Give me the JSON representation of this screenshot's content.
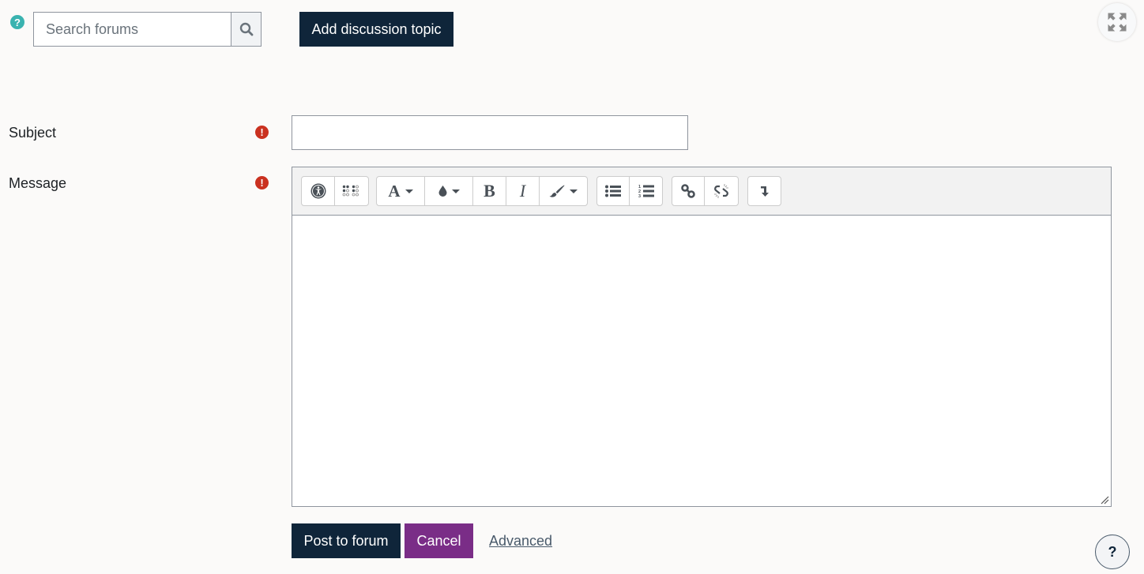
{
  "header": {
    "help_glyph": "?",
    "search": {
      "placeholder": "Search forums",
      "value": ""
    },
    "add_topic_label": "Add discussion topic"
  },
  "form": {
    "subject": {
      "label": "Subject",
      "value": "",
      "required": true,
      "required_glyph": "!"
    },
    "message": {
      "label": "Message",
      "value": "",
      "required": true,
      "required_glyph": "!"
    },
    "toolbar": {
      "groups": [
        [
          {
            "icon": "accessibility-icon",
            "title": "Accessibility checker"
          },
          {
            "icon": "braille-icon",
            "title": "Screenreader helper"
          }
        ],
        [
          {
            "icon": "font-icon",
            "glyph": "A",
            "dropdown": true
          },
          {
            "icon": "color-drop-icon",
            "dropdown": true
          },
          {
            "icon": "bold-icon",
            "glyph": "B"
          },
          {
            "icon": "italic-icon",
            "glyph": "I"
          },
          {
            "icon": "paintbrush-icon",
            "dropdown": true
          }
        ],
        [
          {
            "icon": "unordered-list-icon"
          },
          {
            "icon": "ordered-list-icon"
          }
        ],
        [
          {
            "icon": "link-icon"
          },
          {
            "icon": "unlink-icon"
          }
        ],
        [
          {
            "icon": "expand-toolbar-icon"
          }
        ]
      ]
    },
    "buttons": {
      "post_label": "Post to forum",
      "cancel_label": "Cancel",
      "advanced_label": "Advanced"
    }
  },
  "footer": {
    "help_glyph": "?"
  },
  "colors": {
    "primary": "#0f253a",
    "secondary": "#7a2d87",
    "required": "#ca3120",
    "help": "#3ab3b0"
  }
}
